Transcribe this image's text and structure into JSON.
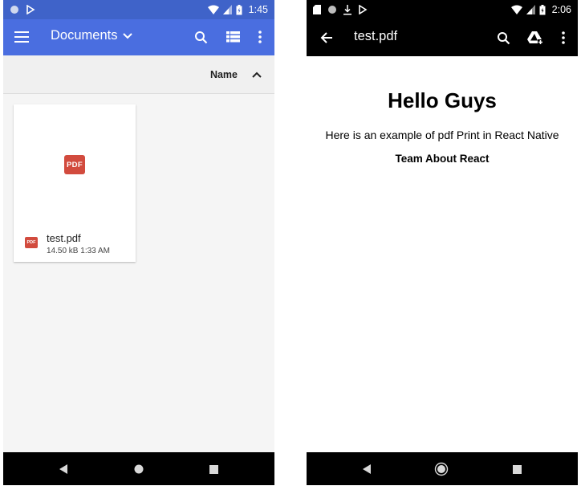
{
  "left": {
    "status": {
      "time": "1:45"
    },
    "toolbar": {
      "title": "Documents"
    },
    "sort": {
      "label": "Name"
    },
    "file": {
      "badge": "PDF",
      "name": "test.pdf",
      "meta": "14.50 kB 1:33 AM"
    },
    "colors": {
      "statusbar": "#3f63c9",
      "toolbar": "#4a6ee0",
      "pdf_red": "#d24b3e"
    }
  },
  "right": {
    "status": {
      "time": "2:06"
    },
    "toolbar": {
      "title": "test.pdf"
    },
    "document": {
      "heading": "Hello Guys",
      "paragraph": "Here is an example of pdf Print in React Native",
      "footer": "Team About React"
    }
  },
  "icons": [
    "menu-icon",
    "chevron-down-icon",
    "search-icon",
    "list-view-icon",
    "more-vert-icon",
    "chevron-up-icon",
    "back-arrow-icon",
    "drive-add-icon",
    "nav-back-icon",
    "nav-home-icon",
    "nav-recents-icon",
    "wifi-icon",
    "signal-icon",
    "battery-icon"
  ]
}
